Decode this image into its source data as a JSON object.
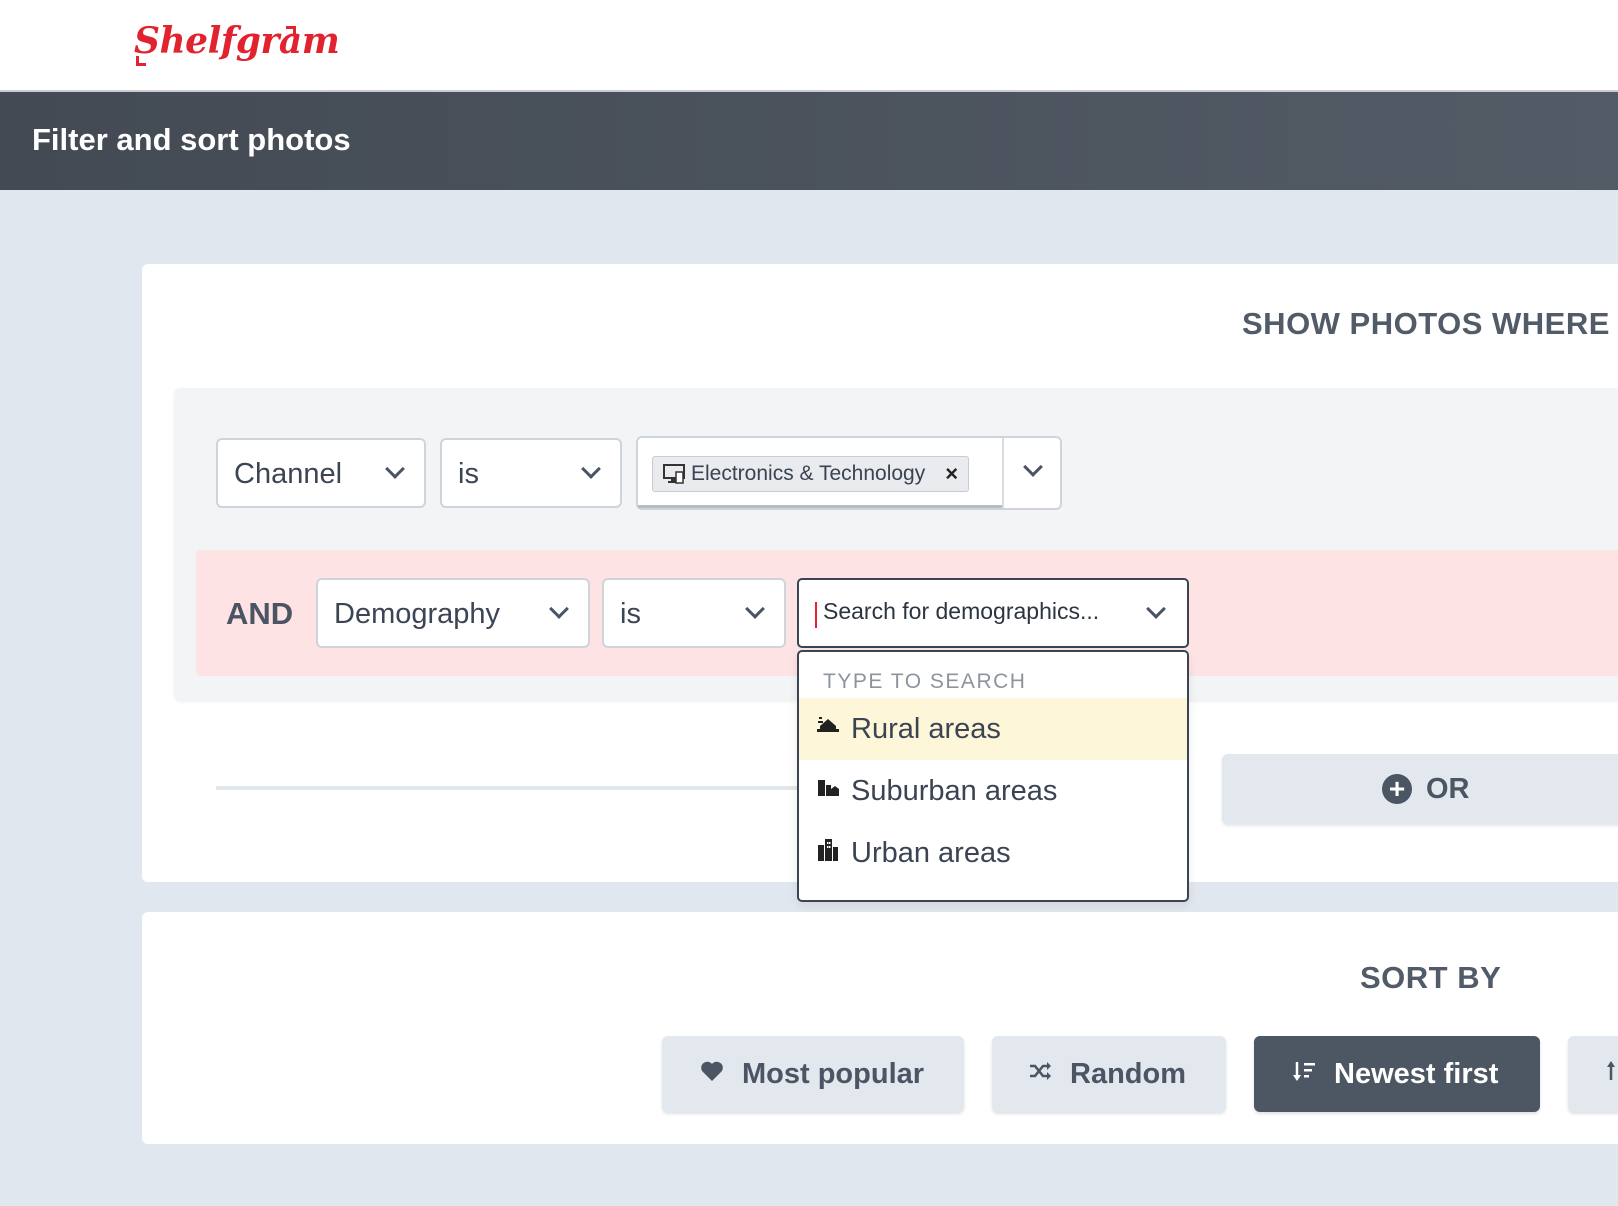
{
  "brand": {
    "name": "Shelfgram",
    "color": "#e0232f"
  },
  "header": {
    "title": "Filter and sort photos"
  },
  "filter": {
    "section_title": "SHOW PHOTOS WHERE",
    "row1": {
      "field": "Channel",
      "operator": "is",
      "selected_chip": {
        "label": "Electronics & Technology",
        "icon": "monitor-icon"
      }
    },
    "row2": {
      "conjunction": "AND",
      "field": "Demography",
      "operator": "is",
      "search_placeholder": "Search for demographics...",
      "dropdown": {
        "header": "TYPE TO SEARCH",
        "options": [
          {
            "label": "Rural areas",
            "icon": "house-icon",
            "highlighted": true
          },
          {
            "label": "Suburban areas",
            "icon": "buildings-icon",
            "highlighted": false
          },
          {
            "label": "Urban areas",
            "icon": "city-icon",
            "highlighted": false
          }
        ]
      }
    },
    "or_button": "OR"
  },
  "sort": {
    "section_title": "SORT BY",
    "options": [
      {
        "label": "Most popular",
        "icon": "heart-icon",
        "active": false
      },
      {
        "label": "Random",
        "icon": "shuffle-icon",
        "active": false
      },
      {
        "label": "Newest first",
        "icon": "sort-desc-icon",
        "active": true
      },
      {
        "label": "",
        "icon": "sort-asc-icon",
        "active": false
      }
    ]
  },
  "colors": {
    "accent": "#e0232f",
    "active_sort": "#4d5663",
    "and_row": "#fde3e3",
    "highlight": "#fdf6d9"
  }
}
